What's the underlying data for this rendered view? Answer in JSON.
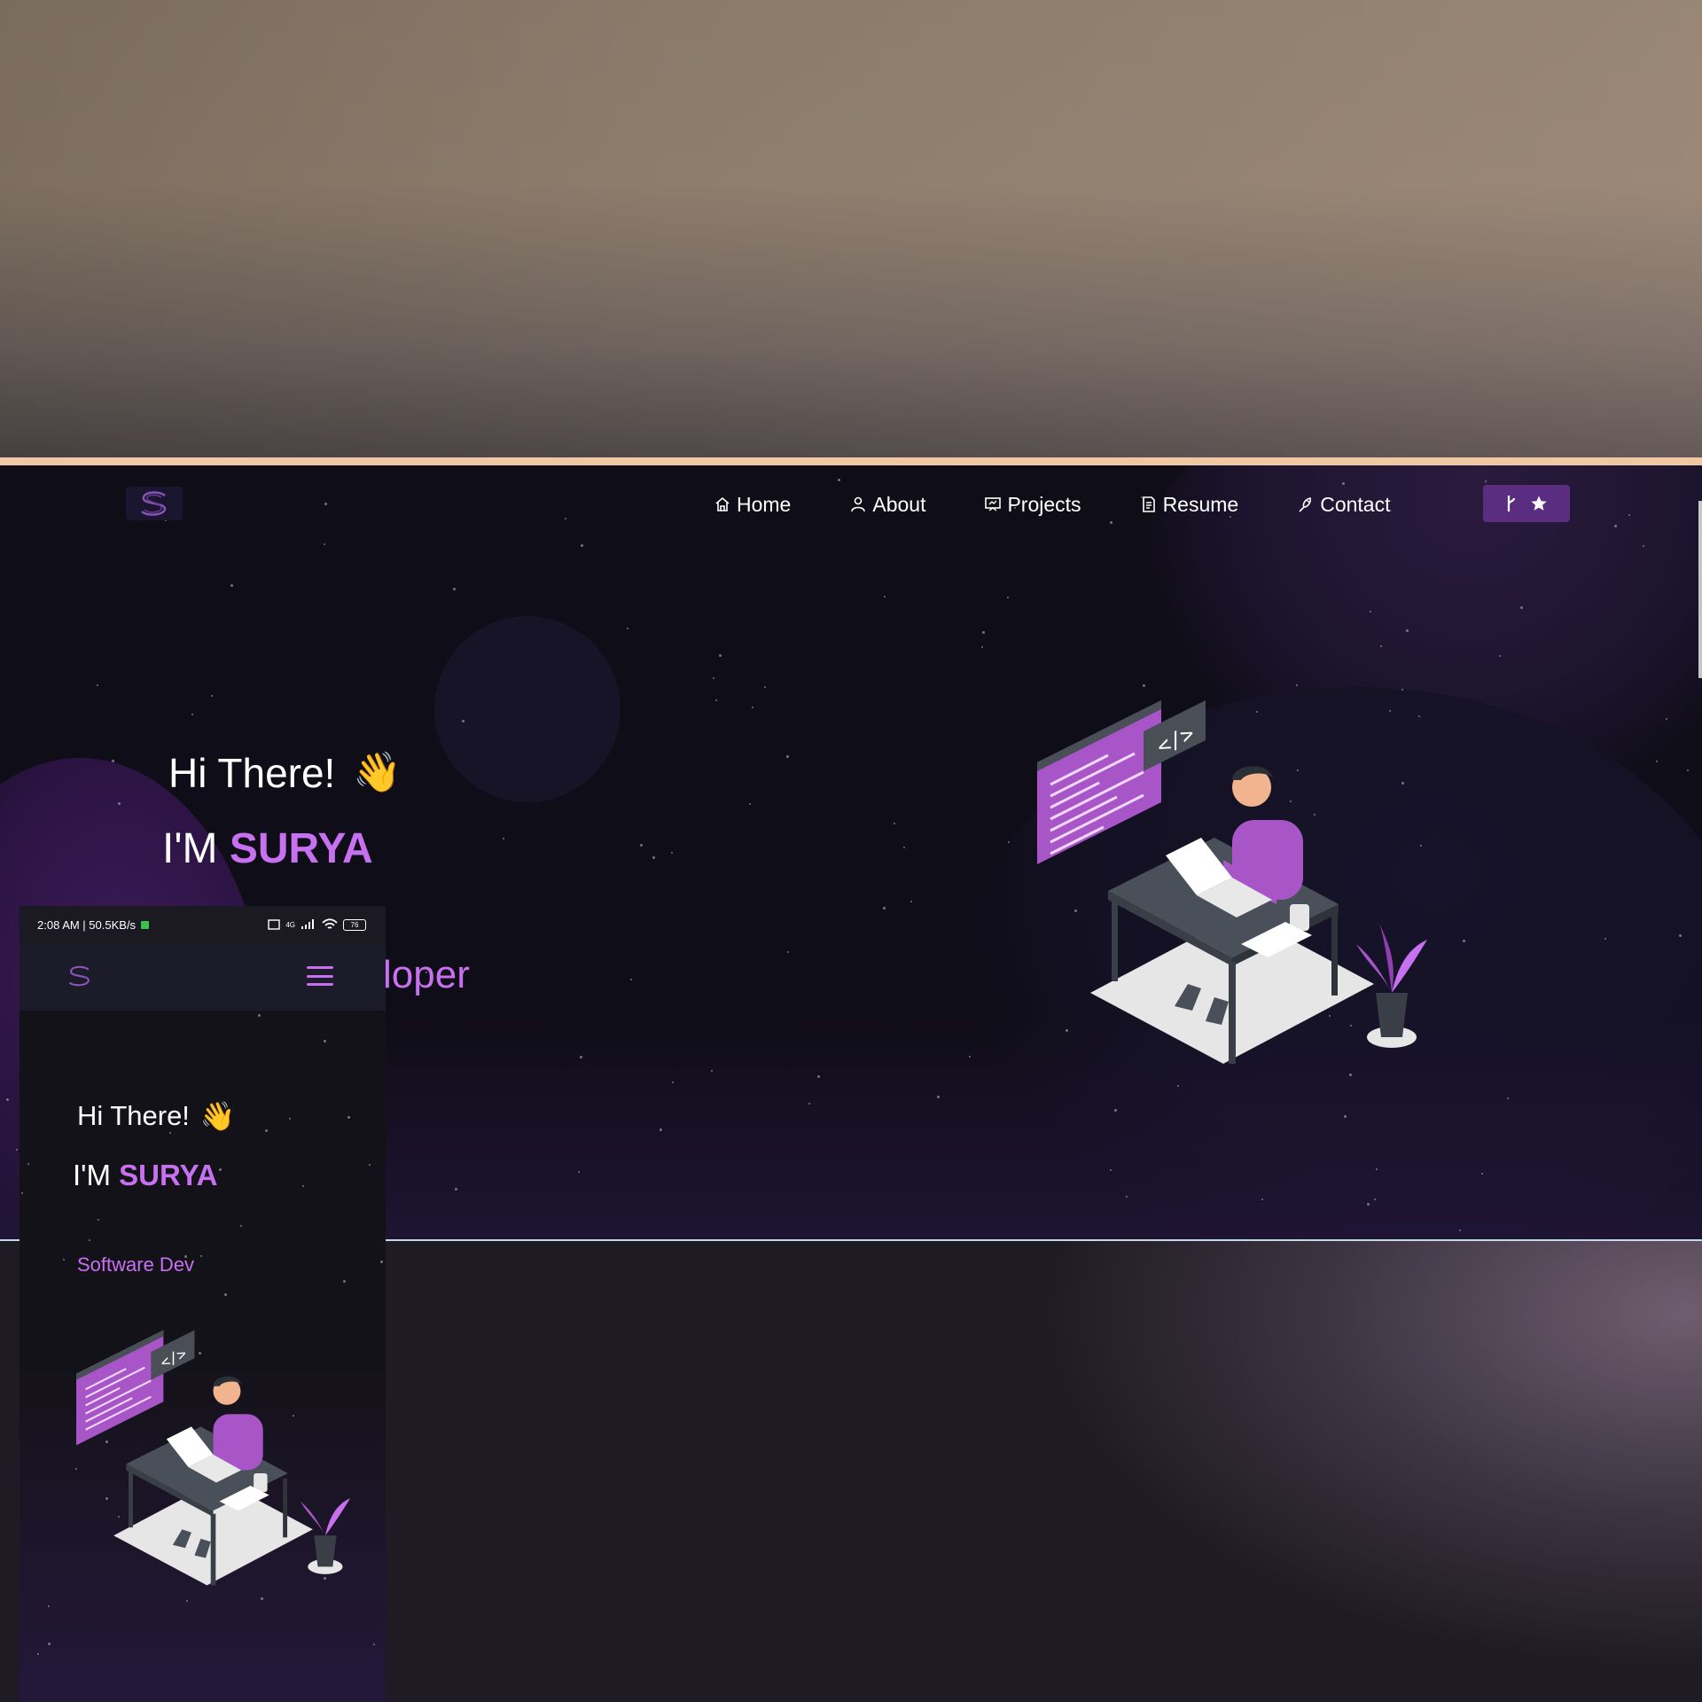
{
  "desktop": {
    "nav": {
      "logo_letter": "S",
      "items": [
        {
          "label": "Home",
          "icon": "home-icon"
        },
        {
          "label": "About",
          "icon": "user-icon"
        },
        {
          "label": "Projects",
          "icon": "projects-icon"
        },
        {
          "label": "Resume",
          "icon": "document-icon"
        },
        {
          "label": "Contact",
          "icon": "contact-icon"
        }
      ],
      "fork_button": {
        "fork_icon": "fork-icon",
        "star_icon": "star-icon"
      }
    },
    "hero": {
      "greeting": "Hi There!",
      "wave": "👋",
      "name_prefix": "I'M ",
      "name": "SURYA",
      "typed_text": "loper"
    }
  },
  "phone": {
    "status": {
      "time_speed": "2:08 AM | 50.5KB/s",
      "network": "4G",
      "battery": "76"
    },
    "nav": {
      "logo_letter": "S",
      "menu_icon": "hamburger-icon"
    },
    "hero": {
      "greeting": "Hi There!",
      "wave": "👋",
      "name_prefix": "I'M ",
      "name": "SURYA",
      "typed_text": "Software Dev"
    }
  },
  "colors": {
    "accent": "#c770f0",
    "background": "#0f0d17",
    "button": "#5b2d80"
  }
}
